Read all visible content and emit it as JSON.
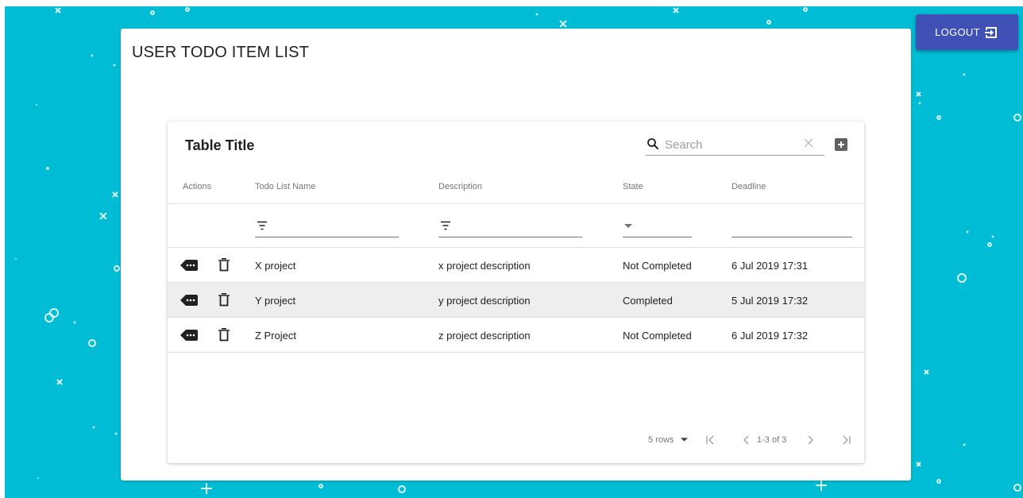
{
  "header": {
    "logout_label": "LOGOUT"
  },
  "page": {
    "title": "USER TODO ITEM LIST"
  },
  "table": {
    "title": "Table Title",
    "search_placeholder": "Search",
    "columns": [
      "Actions",
      "Todo List Name",
      "Description",
      "State",
      "Deadline"
    ],
    "rows": [
      {
        "name": "X project",
        "description": "x project description",
        "state": "Not Completed",
        "deadline": "6 Jul 2019 17:31"
      },
      {
        "name": "Y project",
        "description": "y project description",
        "state": "Completed",
        "deadline": "5 Jul 2019 17:32"
      },
      {
        "name": "Z Project",
        "description": "z project description",
        "state": "Not Completed",
        "deadline": "6 Jul 2019 17:32"
      }
    ],
    "pagination": {
      "rows_label": "5 rows",
      "range_label": "1-3 of 3"
    }
  },
  "icons": {
    "logout": "logout-icon",
    "search": "search-icon",
    "clear": "close-icon",
    "add": "add-box-icon",
    "filter": "filter-list-icon",
    "dropdown": "arrow-drop-down-icon",
    "row_detail": "more-tag-icon",
    "row_delete": "trash-icon",
    "first_page": "first-page-icon",
    "prev_page": "chevron-left-icon",
    "next_page": "chevron-right-icon",
    "last_page": "last-page-icon"
  },
  "colors": {
    "background": "#00bcd4",
    "primary": "#3f51b5",
    "selected_row": "#eeeeee"
  }
}
